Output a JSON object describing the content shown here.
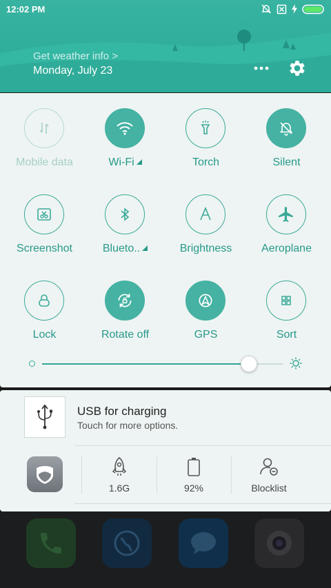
{
  "status_bar": {
    "time": "12:02 PM"
  },
  "header": {
    "weather_link": "Get weather info >",
    "date": "Monday, July 23"
  },
  "toggles": [
    {
      "label": "Mobile data",
      "icon": "mobile-data-icon",
      "state": "disabled"
    },
    {
      "label": "Wi-Fi",
      "icon": "wifi-icon",
      "state": "on",
      "expand": true
    },
    {
      "label": "Torch",
      "icon": "torch-icon",
      "state": "off"
    },
    {
      "label": "Silent",
      "icon": "silent-icon",
      "state": "on"
    },
    {
      "label": "Screenshot",
      "icon": "screenshot-icon",
      "state": "off"
    },
    {
      "label": "Blueto..",
      "icon": "bluetooth-icon",
      "state": "off",
      "expand": true
    },
    {
      "label": "Brightness",
      "icon": "brightness-auto-icon",
      "state": "off"
    },
    {
      "label": "Aeroplane",
      "icon": "airplane-icon",
      "state": "off"
    },
    {
      "label": "Lock",
      "icon": "lock-icon",
      "state": "off"
    },
    {
      "label": "Rotate off",
      "icon": "rotate-lock-icon",
      "state": "on"
    },
    {
      "label": "GPS",
      "icon": "gps-icon",
      "state": "on"
    },
    {
      "label": "Sort",
      "icon": "sort-grid-icon",
      "state": "off"
    }
  ],
  "brightness": {
    "level": 0.86
  },
  "notification": {
    "title": "USB for charging",
    "subtitle": "Touch for more options."
  },
  "quick_items": [
    {
      "icon": "security-shield-icon",
      "label": ""
    },
    {
      "icon": "rocket-cleaner-icon",
      "label": "1.6G"
    },
    {
      "icon": "battery-icon",
      "label": "92%"
    },
    {
      "icon": "blocklist-icon",
      "label": "Blocklist"
    }
  ],
  "colors": {
    "accent": "#45b2a3",
    "header": "#2fae9b",
    "panel": "#eef4f3"
  }
}
